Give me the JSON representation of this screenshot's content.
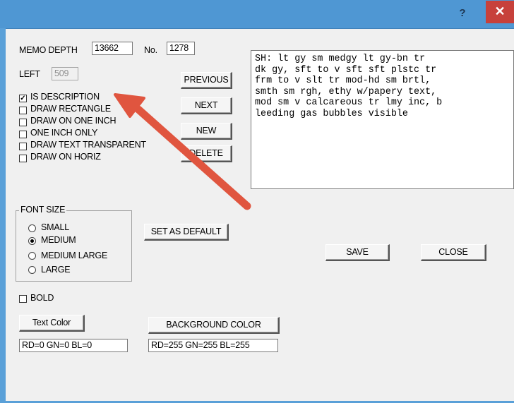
{
  "titlebar": {
    "help_glyph": "?",
    "close_glyph": "✕"
  },
  "memo_depth": {
    "label": "MEMO DEPTH",
    "value": "13662"
  },
  "number": {
    "label": "No.",
    "value": "1278"
  },
  "left": {
    "label": "LEFT",
    "value": "509"
  },
  "options": [
    {
      "label": "IS DESCRIPTION",
      "checked": true
    },
    {
      "label": "DRAW RECTANGLE",
      "checked": false
    },
    {
      "label": "DRAW ON ONE INCH",
      "checked": false
    },
    {
      "label": "ONE INCH ONLY",
      "checked": false
    },
    {
      "label": "DRAW TEXT TRANSPARENT",
      "checked": false
    },
    {
      "label": "DRAW ON HORIZ",
      "checked": false
    }
  ],
  "buttons": {
    "previous": "PREVIOUS",
    "next": "NEXT",
    "new": "NEW",
    "delete": "DELETE",
    "set_as_default": "SET AS DEFAULT",
    "save": "SAVE",
    "close": "CLOSE",
    "text_color": "Text Color",
    "background_color": "BACKGROUND COLOR"
  },
  "memo_text": "SH: lt gy sm medgy lt gy-bn tr\ndk gy, sft to v sft sft plstc tr\nfrm to v slt tr mod-hd sm brtl,\nsmth sm rgh, ethy w/papery text,\nmod sm v calcareous tr lmy inc, b\nleeding gas bubbles visible",
  "font_size": {
    "title": "FONT SIZE",
    "options": [
      {
        "label": "SMALL",
        "selected": false
      },
      {
        "label": "MEDIUM",
        "selected": true
      },
      {
        "label": "MEDIUM LARGE",
        "selected": false
      },
      {
        "label": "LARGE",
        "selected": false
      }
    ]
  },
  "bold": {
    "label": "BOLD",
    "checked": false
  },
  "text_color_value": "RD=0  GN=0 BL=0",
  "background_color_value": "RD=255  GN=255 BL=255",
  "colors": {
    "title_bar": "#4f97d3",
    "close_button": "#c7413b",
    "arrow": "#e0553f",
    "dialog_bg": "#f0f0f0"
  }
}
